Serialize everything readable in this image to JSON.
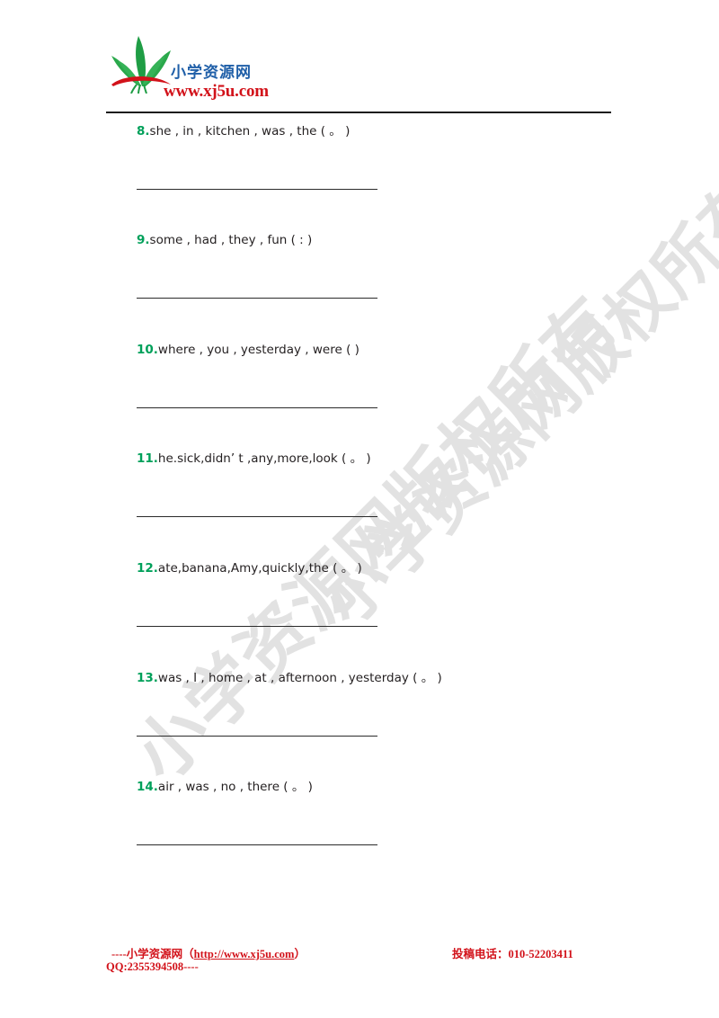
{
  "header": {
    "logo_cn": "小学资源网",
    "logo_url": "www.xj5u.com",
    "logo_icon": "green-sprout-logo"
  },
  "watermark": {
    "line_a": "小学资源网版权所有",
    "line_b": "小学资源网版权所有",
    "color": "#e2e2e2"
  },
  "colors": {
    "question_number": "#00a05a",
    "body_text": "#231f20",
    "footer": "#d2121a",
    "logo_cn": "#1f5fa8",
    "logo_url": "#d2121a",
    "rule": "#1d1d1d"
  },
  "questions": [
    {
      "number": "8.",
      "text": "she , in , kitchen , was , the ( 。 )"
    },
    {
      "number": "9.",
      "text": "some , had , they , fun (  :  )"
    },
    {
      "number": "10.",
      "text": "where , you , yesterday , were (   )"
    },
    {
      "number": "11.",
      "text": "he.sick,didn’ t ,any,more,look ( 。 )"
    },
    {
      "number": "12.",
      "text": "ate,banana,Amy,quickly,the ( 。 )"
    },
    {
      "number": "13.",
      "text": "was , I , home , at , afternoon , yesterday ( 。 )"
    },
    {
      "number": "14.",
      "text": "air , was , no , there ( 。 )"
    }
  ],
  "footer": {
    "left_prefix": "----小学资源网（",
    "link": "http://www.xj5u.com",
    "left_suffix": "）",
    "qq": "QQ:2355394508----",
    "right": "投稿电话：010-52203411"
  }
}
